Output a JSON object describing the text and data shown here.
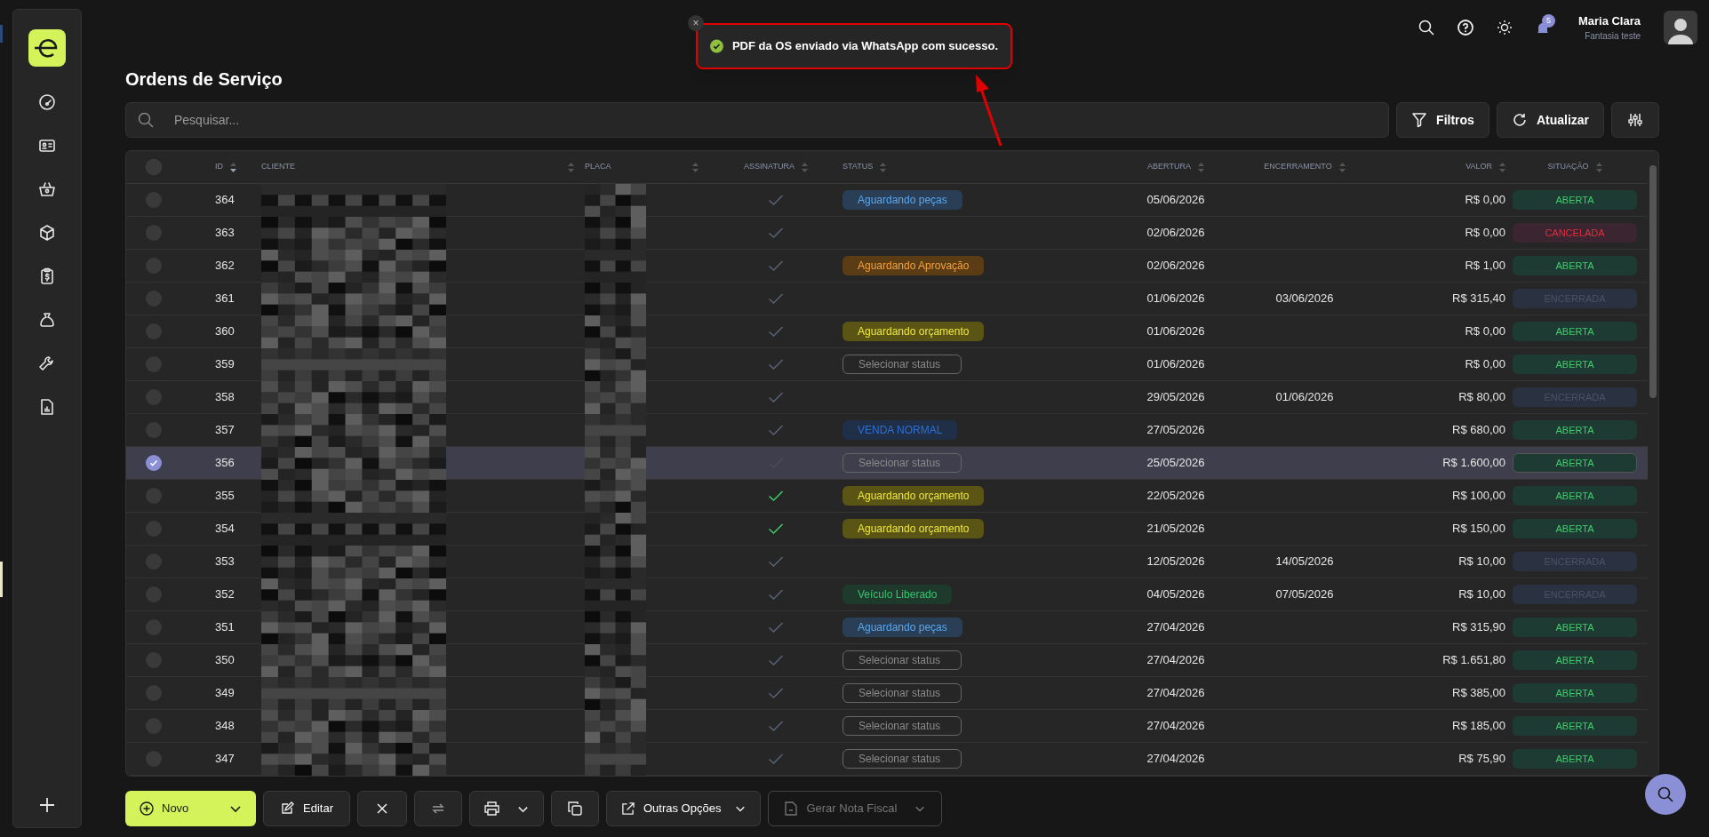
{
  "toast": {
    "message": "PDF da OS enviado via WhatsApp com sucesso.",
    "close": "×"
  },
  "header": {
    "notifications": "5",
    "user_name": "Maria Clara",
    "user_company": "Fantasia teste"
  },
  "page_title": "Ordens de Serviço",
  "search": {
    "placeholder": "Pesquisar..."
  },
  "toolbar_buttons": [
    "Filtros",
    "Atualizar"
  ],
  "table": {
    "select_all": {
      "checked": false
    },
    "columns": [
      "ID",
      "CLIENTE",
      "PLACA",
      "ASSINATURA",
      "STATUS",
      "ABERTURA",
      "ENCERRAMENTO",
      "VALOR",
      "SITUAÇÃO"
    ],
    "rows": [
      {
        "id": "364",
        "selected": false,
        "signed": false,
        "status": {
          "label": "Aguardando peças",
          "kind": "sky"
        },
        "opened": "05/06/2026",
        "closed": "",
        "value": "R$ 0,00",
        "situation": {
          "label": "ABERTA",
          "kind": "open"
        }
      },
      {
        "id": "363",
        "selected": false,
        "signed": false,
        "opened": "02/06/2026",
        "closed": "",
        "value": "R$ 0,00",
        "situation": {
          "label": "CANCELADA",
          "kind": "cancelled"
        }
      },
      {
        "id": "362",
        "selected": false,
        "signed": false,
        "status": {
          "label": "Aguardando Aprovação",
          "kind": "orange"
        },
        "opened": "02/06/2026",
        "closed": "",
        "value": "R$ 1,00",
        "situation": {
          "label": "ABERTA",
          "kind": "open"
        }
      },
      {
        "id": "361",
        "selected": false,
        "signed": false,
        "opened": "01/06/2026",
        "closed": "03/06/2026",
        "value": "R$ 315,40",
        "situation": {
          "label": "ENCERRADA",
          "kind": "closed"
        }
      },
      {
        "id": "360",
        "selected": false,
        "signed": false,
        "status": {
          "label": "Aguardando orçamento",
          "kind": "yellow"
        },
        "opened": "01/06/2026",
        "closed": "",
        "value": "R$ 0,00",
        "situation": {
          "label": "ABERTA",
          "kind": "open"
        }
      },
      {
        "id": "359",
        "selected": false,
        "signed": false,
        "status": {
          "label": "Selecionar status",
          "kind": "empty"
        },
        "opened": "01/06/2026",
        "closed": "",
        "value": "R$ 0,00",
        "situation": {
          "label": "ABERTA",
          "kind": "open"
        }
      },
      {
        "id": "358",
        "selected": false,
        "signed": false,
        "opened": "29/05/2026",
        "closed": "01/06/2026",
        "value": "R$ 80,00",
        "situation": {
          "label": "ENCERRADA",
          "kind": "closed"
        }
      },
      {
        "id": "357",
        "selected": false,
        "signed": false,
        "status": {
          "label": "VENDA NORMAL",
          "kind": "navy"
        },
        "opened": "27/05/2026",
        "closed": "",
        "value": "R$ 680,00",
        "situation": {
          "label": "ABERTA",
          "kind": "open"
        }
      },
      {
        "id": "356",
        "selected": true,
        "signed": false,
        "status": {
          "label": "Selecionar status",
          "kind": "empty"
        },
        "opened": "25/05/2026",
        "closed": "",
        "value": "R$ 1.600,00",
        "situation": {
          "label": "ABERTA",
          "kind": "open"
        }
      },
      {
        "id": "355",
        "selected": false,
        "signed": true,
        "status": {
          "label": "Aguardando orçamento",
          "kind": "yellow"
        },
        "opened": "22/05/2026",
        "closed": "",
        "value": "R$ 100,00",
        "situation": {
          "label": "ABERTA",
          "kind": "open"
        }
      },
      {
        "id": "354",
        "selected": false,
        "signed": true,
        "status": {
          "label": "Aguardando orçamento",
          "kind": "yellow"
        },
        "opened": "21/05/2026",
        "closed": "",
        "value": "R$ 150,00",
        "situation": {
          "label": "ABERTA",
          "kind": "open"
        }
      },
      {
        "id": "353",
        "selected": false,
        "signed": false,
        "opened": "12/05/2026",
        "closed": "14/05/2026",
        "value": "R$ 10,00",
        "situation": {
          "label": "ENCERRADA",
          "kind": "closed"
        }
      },
      {
        "id": "352",
        "selected": false,
        "signed": false,
        "status": {
          "label": "Veículo Liberado",
          "kind": "green"
        },
        "opened": "04/05/2026",
        "closed": "07/05/2026",
        "value": "R$ 10,00",
        "situation": {
          "label": "ENCERRADA",
          "kind": "closed"
        }
      },
      {
        "id": "351",
        "selected": false,
        "signed": false,
        "status": {
          "label": "Aguardando peças",
          "kind": "sky"
        },
        "opened": "27/04/2026",
        "closed": "",
        "value": "R$ 315,90",
        "situation": {
          "label": "ABERTA",
          "kind": "open"
        }
      },
      {
        "id": "350",
        "selected": false,
        "signed": false,
        "status": {
          "label": "Selecionar status",
          "kind": "empty"
        },
        "opened": "27/04/2026",
        "closed": "",
        "value": "R$ 1.651,80",
        "situation": {
          "label": "ABERTA",
          "kind": "open"
        }
      },
      {
        "id": "349",
        "selected": false,
        "signed": false,
        "status": {
          "label": "Selecionar status",
          "kind": "empty"
        },
        "opened": "27/04/2026",
        "closed": "",
        "value": "R$ 385,00",
        "situation": {
          "label": "ABERTA",
          "kind": "open"
        }
      },
      {
        "id": "348",
        "selected": false,
        "signed": false,
        "status": {
          "label": "Selecionar status",
          "kind": "empty"
        },
        "opened": "27/04/2026",
        "closed": "",
        "value": "R$ 185,00",
        "situation": {
          "label": "ABERTA",
          "kind": "open"
        }
      },
      {
        "id": "347",
        "selected": false,
        "signed": false,
        "status": {
          "label": "Selecionar status",
          "kind": "empty"
        },
        "opened": "27/04/2026",
        "closed": "",
        "value": "R$ 75,90",
        "situation": {
          "label": "ABERTA",
          "kind": "open"
        }
      }
    ]
  },
  "actions": {
    "new": "Novo",
    "edit": "Editar",
    "more": "Outras Opções",
    "invoice": {
      "label": "Gerar Nota Fiscal",
      "disabled": true
    }
  }
}
